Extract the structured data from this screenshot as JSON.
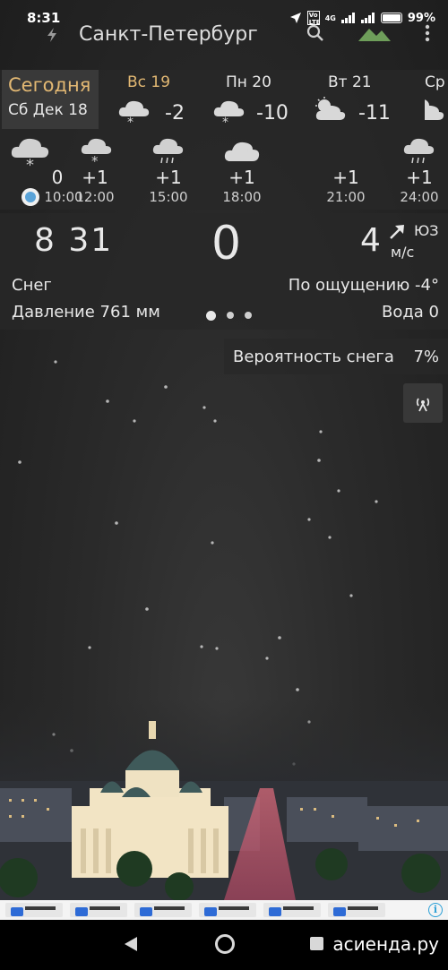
{
  "status_bar": {
    "time": "8:31",
    "network": "4G",
    "volte": "Vo LTE",
    "battery": "99%",
    "icons": [
      "location-icon",
      "volte-icon",
      "signal-icon",
      "signal-icon",
      "battery-icon"
    ]
  },
  "app_bar": {
    "city": "Санкт-Петербург",
    "icons": [
      "refresh-icon",
      "search-icon",
      "landscape-icon",
      "more-vert-icon"
    ]
  },
  "days": {
    "today": {
      "label": "Сегодня",
      "date": "Сб Дек 18"
    },
    "items": [
      {
        "name": "Вс 19",
        "temp": "-2",
        "icon": "snow-cloud-icon",
        "weekend": true
      },
      {
        "name": "Пн 20",
        "temp": "-10",
        "icon": "snow-cloud-icon",
        "weekend": false
      },
      {
        "name": "Вт 21",
        "temp": "-11",
        "icon": "partly-cloudy-icon",
        "weekend": false
      },
      {
        "name": "Ср",
        "temp": "",
        "icon": "partly-cloudy-icon",
        "weekend": false
      }
    ]
  },
  "hours": [
    {
      "value": "0",
      "time": "10:00",
      "icon": "snow-cloud-icon"
    },
    {
      "value": "+1",
      "time": "12:00",
      "icon": "snow-cloud-icon"
    },
    {
      "value": "+1",
      "time": "15:00",
      "icon": "rain-cloud-icon"
    },
    {
      "value": "+1",
      "time": "18:00",
      "icon": "cloud-icon"
    },
    {
      "value": "+1",
      "time": "21:00",
      "icon": "rain-cloud-icon"
    },
    {
      "value": "+1",
      "time": "24:00",
      "icon": "rain-cloud-icon"
    }
  ],
  "current": {
    "time": "8 31",
    "temp": "0",
    "wind_speed": "4",
    "wind_dir": "ЮЗ",
    "wind_unit": "м/с",
    "condition": "Снег",
    "feels_like": "По ощущению -4°",
    "pressure": "Давление 761 мм",
    "water": "Вода 0",
    "pager_active": 0
  },
  "snow_probability": {
    "label": "Вероятность снега",
    "value": "7%"
  },
  "ad": {
    "info": "i"
  },
  "watermark": "асиенда.ру",
  "colors": {
    "accent": "#e2b873",
    "now_dot": "#5aa3d8",
    "panel": "#282828",
    "text": "#e8e8e8"
  }
}
